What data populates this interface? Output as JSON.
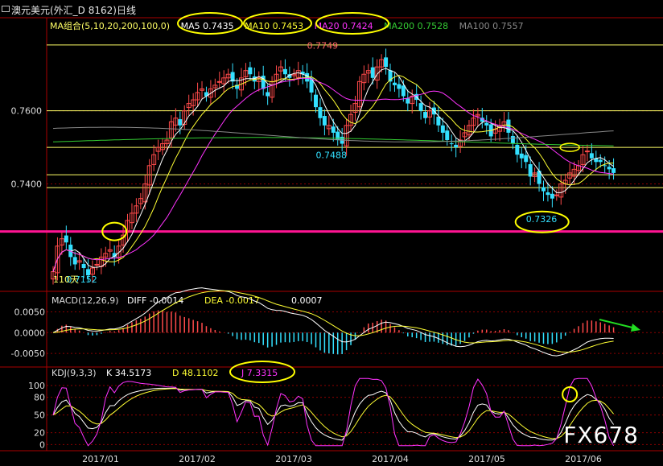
{
  "header": {
    "title": "澳元美元(外汇_D 8162)日线"
  },
  "ma_legend": {
    "group": "MA组合(5,10,20,200,100,0)",
    "ma5": "MA5 0.7435",
    "ma10": "MA10 0.7453",
    "ma20": "MA20 0.7424",
    "ma200": "MA200 0.7528",
    "ma100": "MA100 0.7557"
  },
  "macd_legend": {
    "name": "MACD(12,26,9)",
    "diff": "DIFF  -0.0014",
    "dea": "DEA  -0.0017",
    "macd": "0.0007"
  },
  "kdj_legend": {
    "name": "KDJ(9,3,3)",
    "k": "K  34.5173",
    "d": "D  48.1102",
    "j": "J  7.3315"
  },
  "watermark": "FX678",
  "colors": {
    "bg": "#000000",
    "up": "#ff4a4a",
    "down": "#33e0ff",
    "ma5": "#ffffff",
    "ma10": "#ffff33",
    "ma20": "#ff33ff",
    "ma200": "#33cc33",
    "ma100": "#888888",
    "support": "#ff1493",
    "hline": "#ffff66",
    "grid": "#8b0000",
    "annot": "#ffff00"
  },
  "chart_data": [
    {
      "type": "candlestick",
      "title": "澳元美元(外汇_D 8162)日线",
      "x_ticks": [
        "2017/01",
        "2017/02",
        "2017/03",
        "2017/04",
        "2017/05",
        "2017/06"
      ],
      "y_ticks": [
        "0.7600",
        "0.7400"
      ],
      "ylim": [
        0.7115,
        0.7815
      ],
      "annotations": [
        "0.7749",
        "0.7488",
        "0.7326",
        "0.7152",
        "110天"
      ],
      "support_level": 0.727,
      "horizontal_levels": [
        0.778,
        0.76,
        0.75,
        0.7425,
        0.739
      ],
      "series_close": [
        0.716,
        0.723,
        0.725,
        0.724,
        0.72,
        0.718,
        0.719,
        0.717,
        0.715,
        0.717,
        0.718,
        0.72,
        0.721,
        0.722,
        0.72,
        0.723,
        0.726,
        0.73,
        0.732,
        0.734,
        0.736,
        0.74,
        0.745,
        0.748,
        0.75,
        0.751,
        0.752,
        0.757,
        0.758,
        0.756,
        0.76,
        0.762,
        0.763,
        0.765,
        0.766,
        0.764,
        0.766,
        0.767,
        0.768,
        0.769,
        0.77,
        0.768,
        0.766,
        0.769,
        0.771,
        0.77,
        0.768,
        0.769,
        0.766,
        0.764,
        0.768,
        0.77,
        0.772,
        0.77,
        0.769,
        0.77,
        0.771,
        0.77,
        0.768,
        0.765,
        0.761,
        0.758,
        0.756,
        0.756,
        0.754,
        0.752,
        0.751,
        0.756,
        0.759,
        0.762,
        0.768,
        0.77,
        0.771,
        0.769,
        0.772,
        0.774,
        0.772,
        0.768,
        0.767,
        0.766,
        0.764,
        0.762,
        0.764,
        0.763,
        0.76,
        0.758,
        0.76,
        0.759,
        0.756,
        0.754,
        0.752,
        0.751,
        0.75,
        0.752,
        0.754,
        0.756,
        0.758,
        0.759,
        0.757,
        0.756,
        0.753,
        0.755,
        0.756,
        0.757,
        0.754,
        0.751,
        0.748,
        0.747,
        0.746,
        0.742,
        0.743,
        0.74,
        0.738,
        0.737,
        0.736,
        0.737,
        0.74,
        0.741,
        0.743,
        0.744,
        0.745,
        0.748,
        0.749,
        0.747,
        0.746,
        0.746,
        0.745,
        0.744,
        0.743
      ]
    },
    {
      "type": "macd",
      "name": "MACD(12,26,9)",
      "y_ticks": [
        "0.0050",
        "0.0000",
        "-0.0050"
      ],
      "ylim": [
        -0.0075,
        0.008
      ],
      "diff": -0.0014,
      "dea": -0.0017,
      "macd": 0.0007
    },
    {
      "type": "kdj",
      "name": "KDJ(9,3,3)",
      "y_ticks": [
        "100",
        "80",
        "50",
        "20",
        "0"
      ],
      "ylim": [
        -5,
        115
      ],
      "k": 34.5173,
      "d": 48.1102,
      "j": 7.3315
    }
  ]
}
